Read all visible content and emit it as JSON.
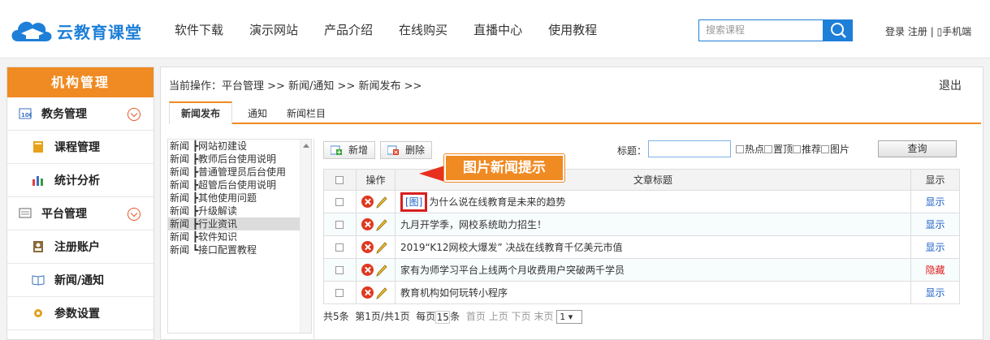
{
  "header": {
    "logo_text": "云教育课堂",
    "nav": [
      "软件下载",
      "演示网站",
      "产品介绍",
      "在线购买",
      "直播中心",
      "使用教程"
    ],
    "search_placeholder": "搜索课程",
    "login": "登录",
    "register": "注册",
    "mobile": "手机端"
  },
  "sidebar": {
    "title": "机构管理",
    "items": [
      {
        "label": "教务管理",
        "level": "top",
        "icon": "course-admin-icon",
        "expandable": true
      },
      {
        "label": "课程管理",
        "level": "sub",
        "icon": "book-icon"
      },
      {
        "label": "统计分析",
        "level": "sub",
        "icon": "bar-chart-icon"
      },
      {
        "label": "平台管理",
        "level": "top",
        "icon": "platform-icon",
        "expandable": true
      },
      {
        "label": "注册账户",
        "level": "sub",
        "icon": "account-icon"
      },
      {
        "label": "新闻/通知",
        "level": "sub",
        "icon": "news-icon"
      },
      {
        "label": "参数设置",
        "level": "sub",
        "icon": "gear-icon"
      }
    ]
  },
  "breadcrumb": "当前操作：平台管理 >> 新闻/通知 >> 新闻发布 >>",
  "logout": "退出",
  "tabs": [
    "新闻发布",
    "通知",
    "新闻栏目"
  ],
  "tree": [
    "新闻 ┣网站初建设",
    "新闻 ┣教师后台使用说明",
    "新闻 ┣普通管理员后台使用",
    "新闻 ┣超管后台使用说明",
    "新闻 ┣其他使用问题",
    "新闻 ┣升级解读",
    "新闻 ┣行业资讯",
    "新闻 ┣软件知识",
    "新闻 ┗接口配置教程"
  ],
  "toolbar": {
    "add": "新增",
    "delete": "删除",
    "title_label": "标题：",
    "filters": [
      "热点",
      "置顶",
      "推荐",
      "图片"
    ],
    "query": "查询"
  },
  "table": {
    "headers": {
      "op": "操作",
      "title": "文章标题",
      "show": "显示"
    },
    "rows": [
      {
        "tag": "[图]",
        "title": "为什么说在线教育是未来的趋势",
        "status": "显示"
      },
      {
        "tag": "",
        "title": "九月开学季，网校系统助力招生！",
        "status": "显示"
      },
      {
        "tag": "",
        "title": "2019“K12网校大爆发” 决战在线教育千亿美元市值",
        "status": "显示"
      },
      {
        "tag": "",
        "title": "家有为师学习平台上线两个月收费用户突破两千学员",
        "status": "隐藏"
      },
      {
        "tag": "",
        "title": "教育机构如何玩转小程序",
        "status": "显示"
      }
    ]
  },
  "callout": "图片新闻提示",
  "pager": {
    "total": "共5条",
    "page": "第1页/共1页",
    "per_page_pre": "每页",
    "per_page": "15",
    "per_page_post": "条",
    "first": "首页",
    "prev": "上页",
    "next": "下页",
    "last": "末页",
    "current": "1"
  },
  "colors": {
    "accent": "#f08a22",
    "brand": "#1e7fd8",
    "danger": "#e02020",
    "link": "#1a5fc8"
  }
}
